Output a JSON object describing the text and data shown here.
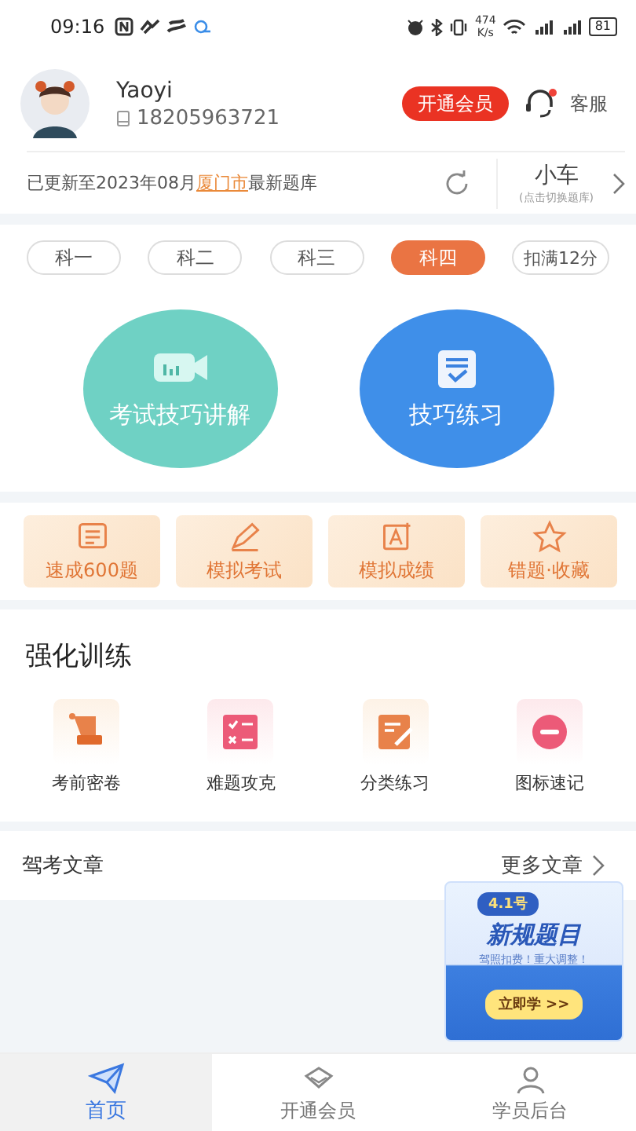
{
  "status_bar": {
    "time": "09:16",
    "speed": "474",
    "speed_unit": "K/s",
    "battery": "81"
  },
  "profile": {
    "name": "Yaoyi",
    "phone": "18205963721",
    "vip_button": "开通会员",
    "service": {
      "label": "客服",
      "notification": true
    }
  },
  "update_notice": {
    "text": "已更新至2023年08月",
    "city": "厦门市",
    "suffix": "最新题库"
  },
  "vehicle": {
    "label": "小车",
    "hint": "(点击切换题库)"
  },
  "subject_tabs": [
    {
      "label": "科一",
      "selected": false
    },
    {
      "label": "科二",
      "selected": false
    },
    {
      "label": "科三",
      "selected": false
    },
    {
      "label": "科四",
      "selected": true
    },
    {
      "label": "扣满12分",
      "selected": false
    }
  ],
  "main_actions": [
    {
      "label": "考试技巧讲解",
      "kind": "video"
    },
    {
      "label": "技巧练习",
      "kind": "practice"
    }
  ],
  "quick_cards": [
    {
      "label": "速成600题",
      "kind": "list"
    },
    {
      "label": "模拟考试",
      "kind": "pen"
    },
    {
      "label": "模拟成绩",
      "kind": "score"
    },
    {
      "label": "错题·收藏",
      "kind": "star"
    }
  ],
  "training": {
    "title": "强化训练",
    "items": [
      {
        "label": "考前密卷",
        "kind": "scroll"
      },
      {
        "label": "难题攻克",
        "kind": "checklist"
      },
      {
        "label": "分类练习",
        "kind": "edit"
      },
      {
        "label": "图标速记",
        "kind": "sign"
      }
    ]
  },
  "articles": {
    "title": "驾考文章",
    "more": "更多文章"
  },
  "promo": {
    "badge": "4.1号",
    "title": "新规题目",
    "subtitle": "驾照扣费！重大调整！",
    "button": "立即学 >>"
  },
  "bottom_nav": [
    {
      "label": "首页",
      "kind": "home",
      "selected": true
    },
    {
      "label": "开通会员",
      "kind": "vip",
      "selected": false
    },
    {
      "label": "学员后台",
      "kind": "student",
      "selected": false
    }
  ]
}
